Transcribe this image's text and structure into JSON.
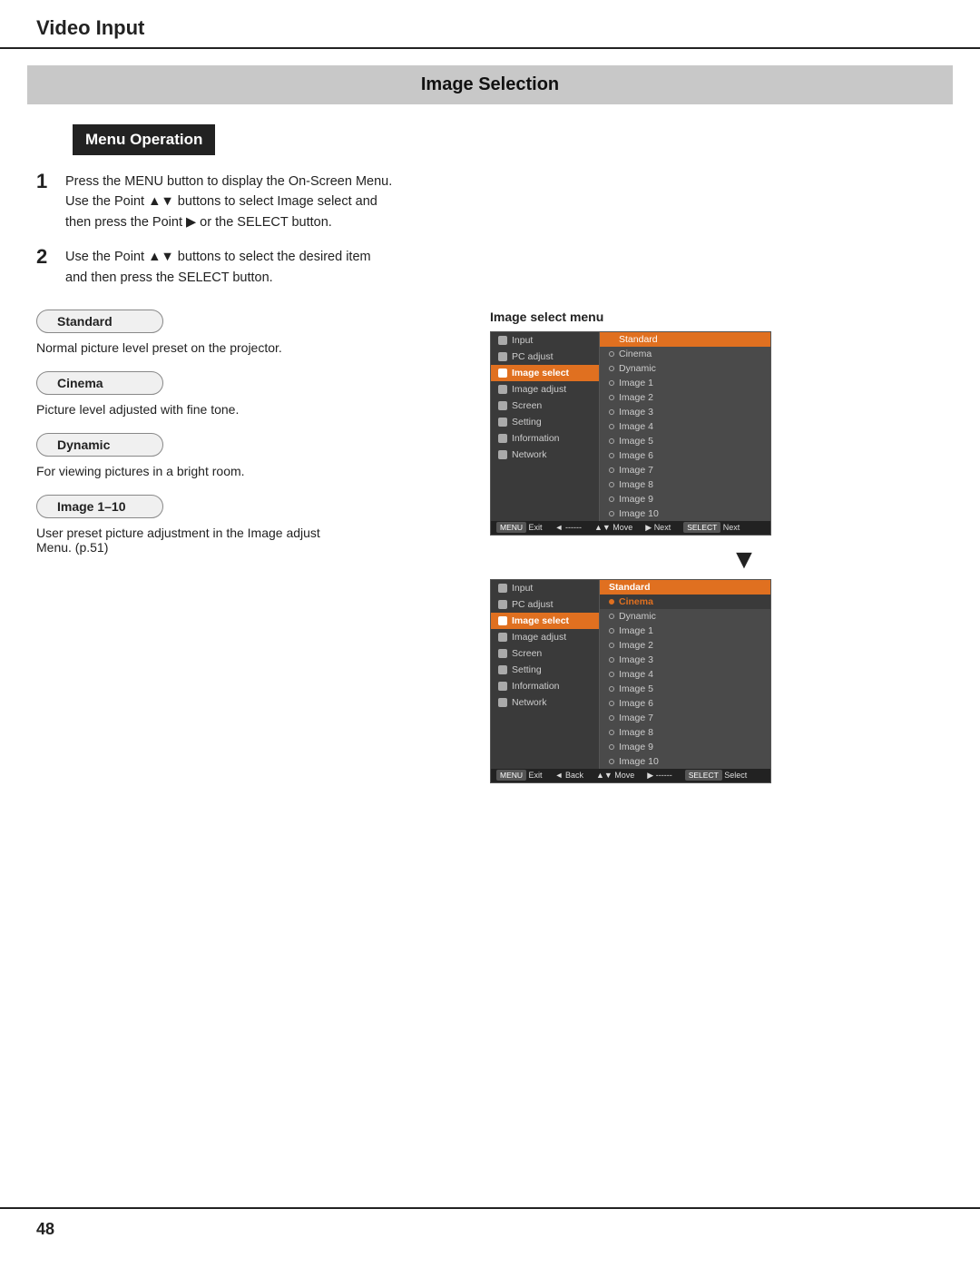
{
  "header": {
    "title": "Video Input"
  },
  "section": {
    "title": "Image Selection"
  },
  "menu_operation": {
    "label": "Menu Operation"
  },
  "steps": [
    {
      "number": "1",
      "text": "Press the MENU button to display the On-Screen Menu.\nUse the Point ▲▼ buttons to select Image select and\nthen press the Point ▶ or the SELECT button."
    },
    {
      "number": "2",
      "text": "Use the Point ▲▼ buttons to select the desired item\nand then press the SELECT button."
    }
  ],
  "items": [
    {
      "label": "Standard",
      "desc": "Normal picture level preset on the projector."
    },
    {
      "label": "Cinema",
      "desc": "Picture level adjusted with fine tone."
    },
    {
      "label": "Dynamic",
      "desc": "For viewing pictures in a bright room."
    },
    {
      "label": "Image 1–10",
      "desc": "User preset picture adjustment in the Image adjust\nMenu. (p.51)"
    }
  ],
  "menu1": {
    "label": "Image select menu",
    "left_items": [
      {
        "label": "Input",
        "active": false
      },
      {
        "label": "PC adjust",
        "active": false
      },
      {
        "label": "Image select",
        "active": true
      },
      {
        "label": "Image adjust",
        "active": false
      },
      {
        "label": "Screen",
        "active": false
      },
      {
        "label": "Setting",
        "active": false
      },
      {
        "label": "Information",
        "active": false
      },
      {
        "label": "Network",
        "active": false
      }
    ],
    "right_items": [
      {
        "label": "Standard",
        "selected": true
      },
      {
        "label": "Cinema",
        "selected": false
      },
      {
        "label": "Dynamic",
        "selected": false
      },
      {
        "label": "Image 1",
        "selected": false
      },
      {
        "label": "Image 2",
        "selected": false
      },
      {
        "label": "Image 3",
        "selected": false
      },
      {
        "label": "Image 4",
        "selected": false
      },
      {
        "label": "Image 5",
        "selected": false
      },
      {
        "label": "Image 6",
        "selected": false
      },
      {
        "label": "Image 7",
        "selected": false
      },
      {
        "label": "Image 8",
        "selected": false
      },
      {
        "label": "Image 9",
        "selected": false
      },
      {
        "label": "Image 10",
        "selected": false
      }
    ],
    "footer": "MENU Exit  ◄ ------  ▲▼ Move  ▶ Next  SELECT Next"
  },
  "menu2": {
    "left_items": [
      {
        "label": "Input",
        "active": false
      },
      {
        "label": "PC adjust",
        "active": false
      },
      {
        "label": "Image select",
        "active": true
      },
      {
        "label": "Image adjust",
        "active": false
      },
      {
        "label": "Screen",
        "active": false
      },
      {
        "label": "Setting",
        "active": false
      },
      {
        "label": "Information",
        "active": false
      },
      {
        "label": "Network",
        "active": false
      }
    ],
    "right_items": [
      {
        "label": "Standard",
        "selected": false
      },
      {
        "label": "Cinema",
        "selected": true
      },
      {
        "label": "Dynamic",
        "selected": false
      },
      {
        "label": "Image 1",
        "selected": false
      },
      {
        "label": "Image 2",
        "selected": false
      },
      {
        "label": "Image 3",
        "selected": false
      },
      {
        "label": "Image 4",
        "selected": false
      },
      {
        "label": "Image 5",
        "selected": false
      },
      {
        "label": "Image 6",
        "selected": false
      },
      {
        "label": "Image 7",
        "selected": false
      },
      {
        "label": "Image 8",
        "selected": false
      },
      {
        "label": "Image 9",
        "selected": false
      },
      {
        "label": "Image 10",
        "selected": false
      }
    ],
    "footer": "MENU Exit  ◄ Back  ▲▼ Move  ▶ ------  SELECT Select"
  },
  "page_number": "48"
}
